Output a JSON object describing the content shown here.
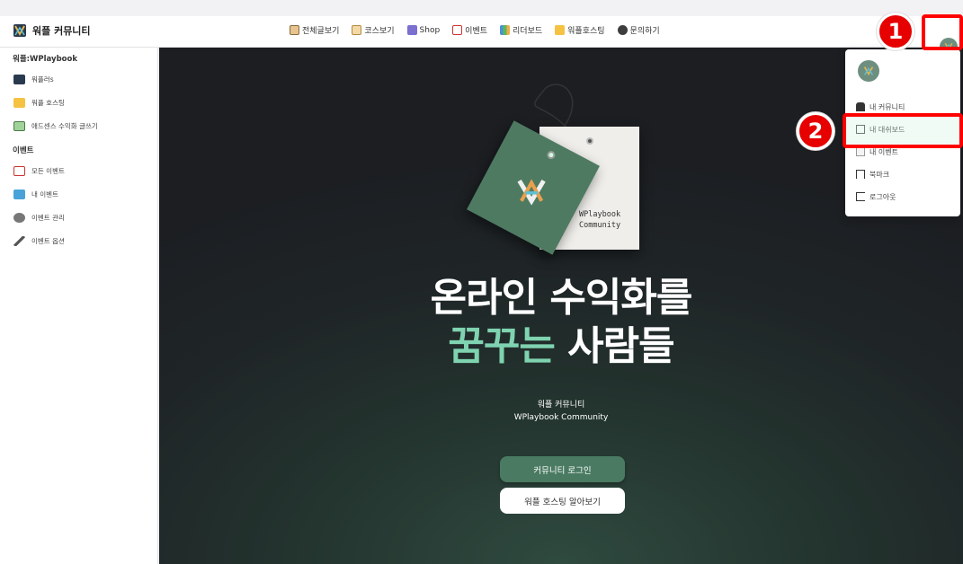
{
  "header": {
    "brand": "워플 커뮤니티",
    "nav": [
      {
        "label": "전체글보기",
        "icon": "house-icon"
      },
      {
        "label": "코스보기",
        "icon": "scroll-icon"
      },
      {
        "label": "Shop",
        "icon": "shop-icon"
      },
      {
        "label": "이벤트",
        "icon": "calendar-icon"
      },
      {
        "label": "리더보드",
        "icon": "chart-icon"
      },
      {
        "label": "워플호스팅",
        "icon": "folder-icon"
      },
      {
        "label": "문의하기",
        "icon": "speech-bubble-icon"
      }
    ]
  },
  "sidebar": {
    "section1": "워플:WPlaybook",
    "items1": [
      {
        "label": "워플러s",
        "icon": "wplaybook-logo-icon"
      },
      {
        "label": "워플 호스팅",
        "icon": "folder-icon"
      },
      {
        "label": "애드센스 수익화 글쓰기",
        "icon": "money-icon"
      }
    ],
    "section2": "이벤트",
    "items2": [
      {
        "label": "모든 이벤트",
        "icon": "calendar-icon"
      },
      {
        "label": "내 이벤트",
        "icon": "monitor-icon"
      },
      {
        "label": "이벤트 관리",
        "icon": "gear-icon"
      },
      {
        "label": "이벤트 옵션",
        "icon": "pen-icon"
      }
    ]
  },
  "hero": {
    "tag_text_line1": "WPlaybook",
    "tag_text_line2": "Community",
    "headline_line1": "온라인 수익화를",
    "headline_accent": "꿈꾸는",
    "headline_rest": " 사람들",
    "sub_line1": "워플 커뮤니티",
    "sub_line2": "WPlaybook Community",
    "login_button": "커뮤니티 로그인",
    "hosting_button": "워플 호스팅 알아보기"
  },
  "dropdown": {
    "items": [
      {
        "label": "내 커뮤니티",
        "icon": "spy-icon"
      },
      {
        "label": "내 대쉬보드",
        "icon": "scroll-icon"
      },
      {
        "label": "내 이벤트",
        "icon": "calendar-icon"
      },
      {
        "label": "북마크",
        "icon": "bookmark-icon"
      },
      {
        "label": "로그아웃",
        "icon": "logout-icon"
      }
    ]
  },
  "annotations": {
    "badge1": "1",
    "badge2": "2"
  },
  "colors": {
    "accent_green": "#4a7b62",
    "headline_accent": "#7fd3b0",
    "highlight_red": "#ff0000"
  }
}
